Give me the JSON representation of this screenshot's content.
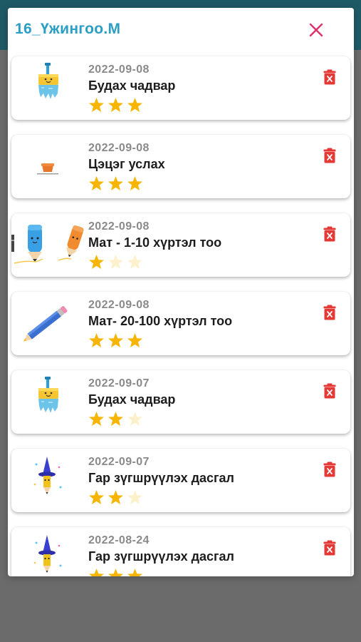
{
  "colors": {
    "title": "#2a9ec4",
    "close": "#e0306a",
    "delete": "#e53935",
    "star_filled": "#f7b500",
    "star_empty": "#fdf1cc",
    "date": "#8a8a8a"
  },
  "modal": {
    "title": "16_Үжингоо.М",
    "close_icon": "close-icon"
  },
  "records": [
    {
      "date": "2022-09-08",
      "name": "Будах чадвар",
      "stars": 3,
      "max_stars": 3,
      "icon": "paint-brush-icon"
    },
    {
      "date": "2022-09-08",
      "name": "Цэцэг услах",
      "stars": 3,
      "max_stars": 3,
      "icon": "flower-pot-icon"
    },
    {
      "date": "2022-09-08",
      "name": "Мат - 1-10 хүртэл тоо",
      "stars": 1,
      "max_stars": 3,
      "icon": "pencils-icon"
    },
    {
      "date": "2022-09-08",
      "name": "Мат- 20-100 хүртэл тоо",
      "stars": 3,
      "max_stars": 3,
      "icon": "pencil-icon"
    },
    {
      "date": "2022-09-07",
      "name": "Будах чадвар",
      "stars": 2,
      "max_stars": 3,
      "icon": "paint-brush-icon"
    },
    {
      "date": "2022-09-07",
      "name": "Гар зүгшрүүлэх дасгал",
      "stars": 2,
      "max_stars": 3,
      "icon": "wizard-pencil-icon"
    },
    {
      "date": "2022-08-24",
      "name": "Гар зүгшрүүлэх дасгал",
      "stars": 3,
      "max_stars": 3,
      "icon": "wizard-pencil-icon"
    }
  ]
}
